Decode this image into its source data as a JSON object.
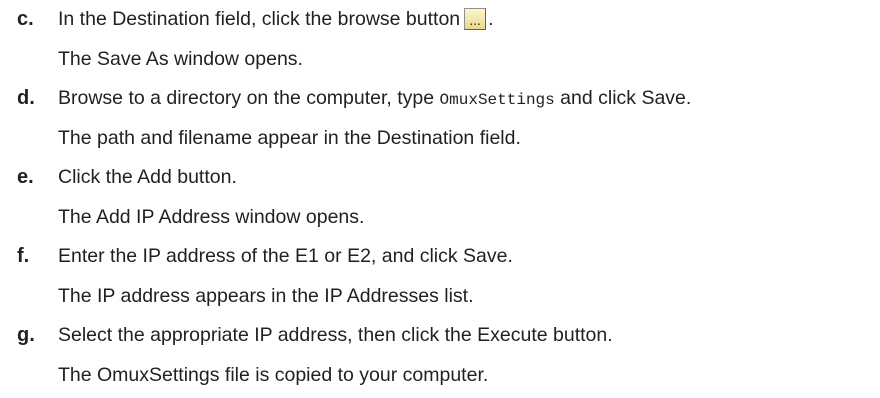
{
  "steps": [
    {
      "letter": "c.",
      "instruction_before": "In the Destination field, click the browse button",
      "button_label": "...",
      "instruction_after": ".",
      "result": "The Save As window opens."
    },
    {
      "letter": "d.",
      "instruction_before": "Browse to a directory on the computer, type ",
      "code": "OmuxSettings",
      "instruction_after": " and click Save.",
      "result": "The path and filename appear in the Destination field."
    },
    {
      "letter": "e.",
      "instruction": "Click the Add button.",
      "result": "The Add IP Address window opens."
    },
    {
      "letter": "f.",
      "instruction": "Enter the IP address of the E1 or E2, and click Save.",
      "result": "The IP address appears in the IP Addresses list."
    },
    {
      "letter": "g.",
      "instruction": "Select the appropriate IP address, then click the Execute button.",
      "result": "The OmuxSettings file is copied to your computer."
    }
  ]
}
